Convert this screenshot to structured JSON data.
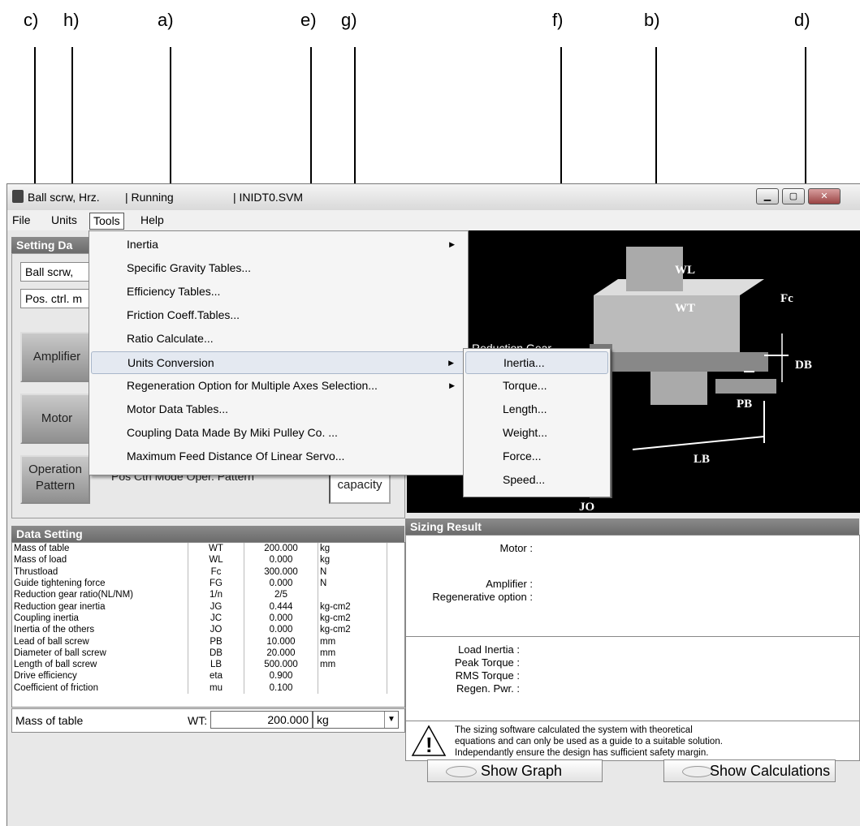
{
  "callouts": [
    "c)",
    "h)",
    "a)",
    "e)",
    "g)",
    "f)",
    "b)",
    "d)"
  ],
  "titlebar": {
    "app_icon": "app-icon",
    "mechanism": "Ball scrw, Hrz.",
    "status": "| Running",
    "file": "| INIDT0.SVM"
  },
  "menubar": [
    "File",
    "Units",
    "Tools",
    "Help"
  ],
  "tools_menu": [
    {
      "label": "Inertia",
      "submenu": true
    },
    {
      "label": "Specific Gravity Tables..."
    },
    {
      "label": "Efficiency Tables..."
    },
    {
      "label": "Friction Coeff.Tables..."
    },
    {
      "label": "Ratio Calculate..."
    },
    {
      "label": "Units Conversion",
      "submenu": true
    },
    {
      "label": "Regeneration Option for Multiple Axes Selection...",
      "submenu": true
    },
    {
      "label": "Motor Data Tables..."
    },
    {
      "label": "Coupling Data Made By Miki Pulley Co. ..."
    },
    {
      "label": "Maximum Feed Distance Of Linear Servo..."
    }
  ],
  "units_submenu": [
    "Inertia...",
    "Torque...",
    "Length...",
    "Weight...",
    "Force...",
    "Speed..."
  ],
  "setting_data": {
    "title": "Setting Da",
    "field1": "Ball scrw,",
    "field2": "Pos. ctrl. m",
    "amplifier_btn": "Amplifier",
    "motor_btn": "Motor",
    "operation_btn_line1": "Operation",
    "operation_btn_line2": "Pattern",
    "oper_text": "Pos Ctrl Mode Oper. Pattern",
    "calc_btn": "capacity"
  },
  "diagram": {
    "wl": "WL",
    "wt": "WT",
    "fc": "Fc",
    "db": "DB",
    "pb": "PB",
    "lb": "LB",
    "jo": "JO",
    "reduction_label": "Reduction Gear"
  },
  "data_setting": {
    "title": "Data Setting",
    "rows": [
      [
        "Mass of table",
        "WT",
        "200.000",
        "kg"
      ],
      [
        "Mass of load",
        "WL",
        "0.000",
        "kg"
      ],
      [
        "Thrustload",
        "Fc",
        "300.000",
        "N"
      ],
      [
        "Guide tightening force",
        "FG",
        "0.000",
        "N"
      ],
      [
        "Reduction gear ratio(NL/NM)",
        "1/n",
        "2/5",
        ""
      ],
      [
        "Reduction gear inertia",
        "JG",
        "0.444",
        "kg-cm2"
      ],
      [
        "Coupling inertia",
        "JC",
        "0.000",
        "kg-cm2"
      ],
      [
        "Inertia of the others",
        "JO",
        "0.000",
        "kg-cm2"
      ],
      [
        "Lead of ball screw",
        "PB",
        "10.000",
        "mm"
      ],
      [
        "Diameter of ball screw",
        "DB",
        "20.000",
        "mm"
      ],
      [
        "Length of ball screw",
        "LB",
        "500.000",
        "mm"
      ],
      [
        "Drive efficiency",
        "eta",
        "0.900",
        ""
      ],
      [
        "Coefficient of friction",
        "mu",
        "0.100",
        ""
      ]
    ],
    "edit_label": "Mass of table",
    "edit_sym": "WT:",
    "edit_value": "200.000",
    "edit_unit": "kg"
  },
  "sizing_result": {
    "title": "Sizing Result",
    "motor": "Motor :",
    "amplifier": "Amplifier :",
    "regen_option": "Regenerative option :",
    "load_inertia": "Load Inertia :",
    "peak_torque": "Peak Torque :",
    "rms_torque": "RMS Torque :",
    "regen_pwr": "Regen. Pwr. :",
    "warning": [
      "The sizing software calculated the system with theoretical",
      "equations and can only be used as a guide to a suitable solution.",
      "Independantly ensure the design has sufficient safety margin."
    ],
    "show_graph": "Show Graph",
    "show_calc": "Show Calculations"
  }
}
